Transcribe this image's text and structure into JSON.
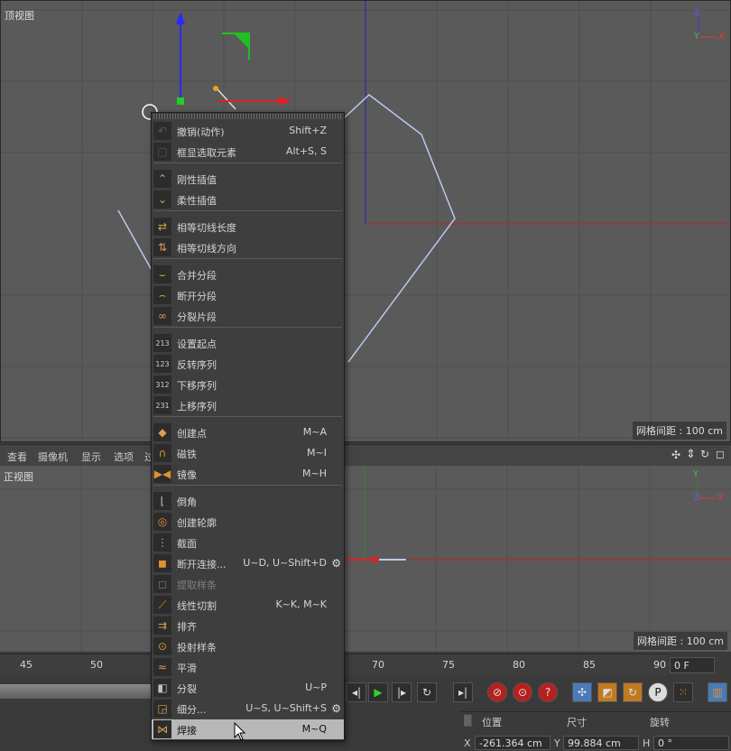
{
  "top_view": {
    "label": "顶视图",
    "grid_info": "网格间距 : 100 cm"
  },
  "front_view": {
    "label": "正视图",
    "grid_info": "网格间距 : 100 cm"
  },
  "viewport_menu": [
    "查看",
    "摄像机",
    "显示",
    "选项",
    "过"
  ],
  "axis_labels": {
    "y": "Y",
    "z": "Z",
    "x": "X"
  },
  "timeline": {
    "ticks": [
      "45",
      "50",
      "70",
      "75",
      "80",
      "85",
      "90"
    ],
    "frame": "0 F"
  },
  "coords": {
    "headers": [
      "位置",
      "尺寸",
      "旋转"
    ],
    "axis_x": "X",
    "axis_y": "Y",
    "axis_h": "H",
    "pos_x": "-261.364 cm",
    "size_y": "99.884 cm",
    "rot_h": "0 °"
  },
  "menu": {
    "items": [
      {
        "label": "撤销(动作)",
        "shortcut": "Shift+Z",
        "icon": "undo-icon"
      },
      {
        "label": "框显选取元素",
        "shortcut": "Alt+S, S",
        "icon": "frame-selection-icon"
      },
      {
        "label": "刚性插值",
        "shortcut": "",
        "icon": "hard-interpolation-icon"
      },
      {
        "label": "柔性插值",
        "shortcut": "",
        "icon": "soft-interpolation-icon"
      },
      {
        "label": "相等切线长度",
        "shortcut": "",
        "icon": "equal-tangent-length-icon"
      },
      {
        "label": "相等切线方向",
        "shortcut": "",
        "icon": "equal-tangent-direction-icon"
      },
      {
        "label": "合并分段",
        "shortcut": "",
        "icon": "join-segment-icon"
      },
      {
        "label": "断开分段",
        "shortcut": "",
        "icon": "break-segment-icon"
      },
      {
        "label": "分裂片段",
        "shortcut": "",
        "icon": "explode-segments-icon"
      },
      {
        "label": "设置起点",
        "shortcut": "",
        "icon": "set-first-point-icon"
      },
      {
        "label": "反转序列",
        "shortcut": "",
        "icon": "reverse-sequence-icon"
      },
      {
        "label": "下移序列",
        "shortcut": "",
        "icon": "move-down-sequence-icon"
      },
      {
        "label": "上移序列",
        "shortcut": "",
        "icon": "move-up-sequence-icon"
      },
      {
        "label": "创建点",
        "shortcut": "M~A",
        "icon": "create-point-icon"
      },
      {
        "label": "磁铁",
        "shortcut": "M~I",
        "icon": "magnet-icon"
      },
      {
        "label": "镜像",
        "shortcut": "M~H",
        "icon": "mirror-icon"
      },
      {
        "label": "倒角",
        "shortcut": "",
        "icon": "chamfer-icon"
      },
      {
        "label": "创建轮廓",
        "shortcut": "",
        "icon": "create-outline-icon"
      },
      {
        "label": "截面",
        "shortcut": "",
        "icon": "cross-section-icon"
      },
      {
        "label": "断开连接...",
        "shortcut": "U~D, U~Shift+D",
        "icon": "disconnect-icon"
      },
      {
        "label": "提取样条",
        "shortcut": "",
        "icon": "extract-spline-icon"
      },
      {
        "label": "线性切割",
        "shortcut": "K~K, M~K",
        "icon": "line-cut-icon"
      },
      {
        "label": "排齐",
        "shortcut": "",
        "icon": "arrange-icon"
      },
      {
        "label": "投射样条",
        "shortcut": "",
        "icon": "project-spline-icon"
      },
      {
        "label": "平滑",
        "shortcut": "",
        "icon": "smooth-icon"
      },
      {
        "label": "分裂",
        "shortcut": "U~P",
        "icon": "split-icon"
      },
      {
        "label": "细分...",
        "shortcut": "U~S, U~Shift+S",
        "icon": "subdivide-icon"
      },
      {
        "label": "焊接",
        "shortcut": "M~Q",
        "icon": "weld-icon"
      }
    ]
  },
  "colors": {
    "x_axis": "#e23a3a",
    "y_axis": "#2d8a2d",
    "z_axis": "#3a3ad8",
    "spline": "#b9c8f0",
    "highlight": "#b8b8b8"
  }
}
